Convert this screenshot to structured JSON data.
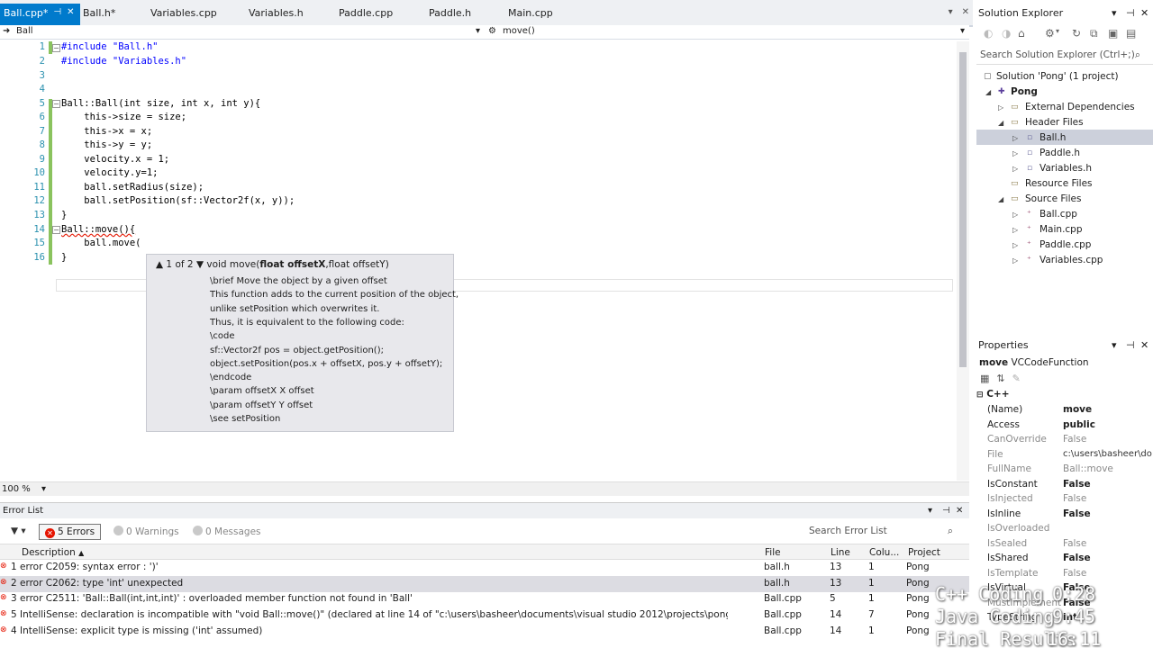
{
  "tabs": [
    {
      "label": "Ball.cpp*",
      "active": true
    },
    {
      "label": "Ball.h*"
    },
    {
      "label": "Variables.cpp"
    },
    {
      "label": "Variables.h"
    },
    {
      "label": "Paddle.cpp"
    },
    {
      "label": "Paddle.h"
    },
    {
      "label": "Main.cpp"
    }
  ],
  "navbar": {
    "scope": "Ball",
    "member": "move()"
  },
  "code": {
    "line_numbers": [
      "1",
      "2",
      "3",
      "4",
      "5",
      "6",
      "7",
      "8",
      "9",
      "10",
      "11",
      "12",
      "13",
      "14",
      "15",
      "16"
    ],
    "lines": [
      "#include \"Ball.h\"",
      "#include \"Variables.h\"",
      "",
      "",
      "Ball::Ball(int size, int x, int y){",
      "    this->size = size;",
      "    this->x = x;",
      "    this->y = y;",
      "    velocity.x = 1;",
      "    velocity.y=1;",
      "    ball.setRadius(size);",
      "    ball.setPosition(sf::Vector2f(x, y));",
      "}",
      "Ball::move(){",
      "    ball.move(",
      "}"
    ]
  },
  "tooltip": {
    "counter": "1 of 2",
    "sig_prefix": "void move(",
    "sig_bold": "float offsetX",
    "sig_suffix": ",float offsetY)",
    "doc": [
      "\\brief Move the object by a given offset",
      "This function adds to the current position of the object,",
      "unlike setPosition which overwrites it.",
      "Thus, it is equivalent to the following code:",
      "\\code",
      "sf::Vector2f pos = object.getPosition();",
      "object.setPosition(pos.x + offsetX, pos.y + offsetY);",
      "\\endcode",
      "\\param offsetX X offset",
      "\\param offsetY Y offset",
      "\\see setPosition"
    ]
  },
  "zoom": "100 %",
  "error_list": {
    "title": "Error List",
    "errors_btn": "5 Errors",
    "warnings_btn": "0 Warnings",
    "messages_btn": "0 Messages",
    "search_placeholder": "Search Error List",
    "columns": {
      "description": "Description",
      "file": "File",
      "line": "Line",
      "column": "Colu...",
      "project": "Project"
    },
    "rows": [
      {
        "num": "1",
        "desc": "error C2059: syntax error : ')'",
        "file": "ball.h",
        "line": "13",
        "col": "1",
        "project": "Pong",
        "selected": false
      },
      {
        "num": "2",
        "desc": "error C2062: type 'int' unexpected",
        "file": "ball.h",
        "line": "13",
        "col": "1",
        "project": "Pong",
        "selected": true
      },
      {
        "num": "3",
        "desc": "error C2511: 'Ball::Ball(int,int,int)' : overloaded member function not found in 'Ball'",
        "file": "Ball.cpp",
        "line": "5",
        "col": "1",
        "project": "Pong",
        "selected": false
      },
      {
        "num": "5",
        "desc": "IntelliSense: declaration is incompatible with \"void Ball::move()\" (declared at line 14 of \"c:\\users\\basheer\\documents\\visual studio 2012\\projects\\pong\\pong\\Ball.h\")",
        "file": "Ball.cpp",
        "line": "14",
        "col": "7",
        "project": "Pong",
        "selected": false
      },
      {
        "num": "4",
        "desc": "IntelliSense: explicit type is missing ('int' assumed)",
        "file": "Ball.cpp",
        "line": "14",
        "col": "1",
        "project": "Pong",
        "selected": false
      }
    ]
  },
  "solution_explorer": {
    "title": "Solution Explorer",
    "search_placeholder": "Search Solution Explorer (Ctrl+;)",
    "solution": "Solution 'Pong' (1 project)",
    "project": "Pong",
    "external": "External Dependencies",
    "header_files": "Header Files",
    "headers": [
      "Ball.h",
      "Paddle.h",
      "Variables.h"
    ],
    "resource_files": "Resource Files",
    "source_files": "Source Files",
    "sources": [
      "Ball.cpp",
      "Main.cpp",
      "Paddle.cpp",
      "Variables.cpp"
    ]
  },
  "properties": {
    "title": "Properties",
    "object_name": "move",
    "object_type": "VCCodeFunction",
    "category": "C++",
    "rows": [
      {
        "name": "(Name)",
        "value": "move",
        "dim": false,
        "bold": true
      },
      {
        "name": "Access",
        "value": "public",
        "dim": false,
        "bold": true
      },
      {
        "name": "CanOverride",
        "value": "False",
        "dim": true,
        "bold": false
      },
      {
        "name": "File",
        "value": "c:\\users\\basheer\\do",
        "dim": true,
        "bold": false
      },
      {
        "name": "FullName",
        "value": "Ball::move",
        "dim": true,
        "bold": false
      },
      {
        "name": "IsConstant",
        "value": "False",
        "dim": false,
        "bold": true
      },
      {
        "name": "IsInjected",
        "value": "False",
        "dim": true,
        "bold": false
      },
      {
        "name": "IsInline",
        "value": "False",
        "dim": false,
        "bold": true
      },
      {
        "name": "IsOverloaded",
        "value": "",
        "dim": true,
        "bold": false
      },
      {
        "name": "IsSealed",
        "value": "False",
        "dim": true,
        "bold": false
      },
      {
        "name": "IsShared",
        "value": "False",
        "dim": false,
        "bold": true
      },
      {
        "name": "IsTemplate",
        "value": "False",
        "dim": true,
        "bold": false
      },
      {
        "name": "IsVirtual",
        "value": "False",
        "dim": false,
        "bold": true
      },
      {
        "name": "MustImplement",
        "value": "False",
        "dim": true,
        "bold": false
      },
      {
        "name": "TypeString",
        "value": "int",
        "dim": false,
        "bold": true
      }
    ]
  },
  "overlay": [
    {
      "label": "C++ Coding",
      "time": "0:28"
    },
    {
      "label": "Java Coding",
      "time": "9:45"
    },
    {
      "label": "Final Results",
      "time": "16:11"
    }
  ]
}
